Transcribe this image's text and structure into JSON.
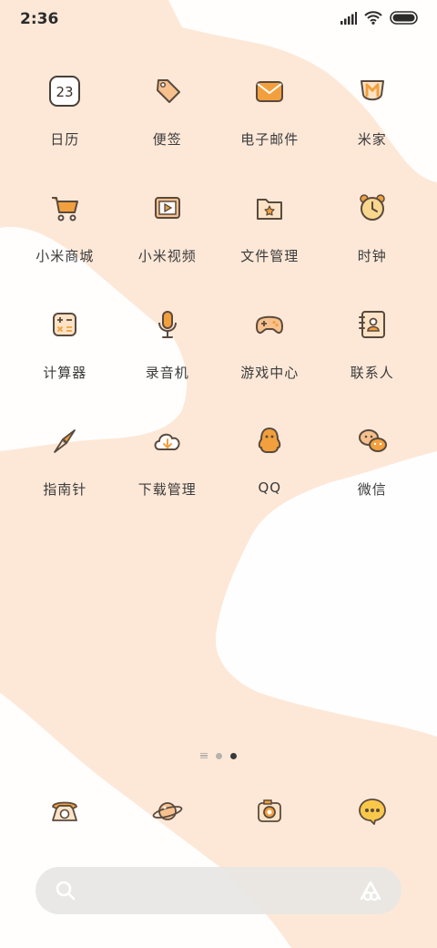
{
  "status_bar": {
    "time": "2:36",
    "icons": [
      "signal-icon",
      "wifi-icon",
      "battery-icon"
    ]
  },
  "apps": [
    {
      "label": "日历",
      "icon": "calendar-icon",
      "icon_text": "23"
    },
    {
      "label": "便签",
      "icon": "tag-icon"
    },
    {
      "label": "电子邮件",
      "icon": "mail-icon"
    },
    {
      "label": "米家",
      "icon": "mijia-icon"
    },
    {
      "label": "小米商城",
      "icon": "cart-icon"
    },
    {
      "label": "小米视频",
      "icon": "video-icon"
    },
    {
      "label": "文件管理",
      "icon": "folder-icon"
    },
    {
      "label": "时钟",
      "icon": "clock-icon"
    },
    {
      "label": "计算器",
      "icon": "calculator-icon"
    },
    {
      "label": "录音机",
      "icon": "microphone-icon"
    },
    {
      "label": "游戏中心",
      "icon": "gamepad-icon"
    },
    {
      "label": "联系人",
      "icon": "contacts-icon"
    },
    {
      "label": "指南针",
      "icon": "compass-icon"
    },
    {
      "label": "下载管理",
      "icon": "cloud-download-icon"
    },
    {
      "label": "QQ",
      "icon": "qq-icon"
    },
    {
      "label": "微信",
      "icon": "wechat-icon"
    }
  ],
  "page_indicator": {
    "pages": 3,
    "active": 3
  },
  "dock": [
    {
      "icon": "phone-icon"
    },
    {
      "icon": "planet-icon"
    },
    {
      "icon": "camera-icon"
    },
    {
      "icon": "message-icon"
    }
  ],
  "search_bar": {
    "left_icon": "search-icon",
    "right_icon": "assistant-icon"
  },
  "colors": {
    "background": "#fde8d8",
    "accent": "#f2a03d",
    "line": "#5a4a3e",
    "cloud": "#ffffff"
  }
}
